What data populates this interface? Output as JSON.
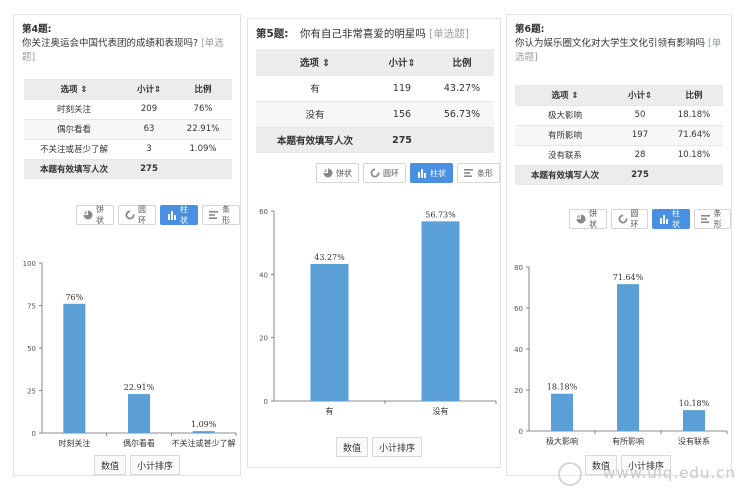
{
  "colors": {
    "bar": "#5a9fd6",
    "active_btn": "#4a90e2",
    "header_bg": "#ececec"
  },
  "table_headers": {
    "option": "选项 ⇕",
    "count": "小计⇕",
    "ratio": "比例"
  },
  "total_label": "本题有效填写人次",
  "chart_buttons": [
    {
      "icon": "pie-icon",
      "label": "饼状"
    },
    {
      "icon": "donut-icon",
      "label": "圆环"
    },
    {
      "icon": "bar-chart-icon",
      "label": "柱状"
    },
    {
      "icon": "bar-horizontal-icon",
      "label": "条形"
    }
  ],
  "bottom_buttons": {
    "values": "数值",
    "sort": "小计排序"
  },
  "watermark": "www.ulq.edu.cn",
  "questions": [
    {
      "num": "第4题:",
      "text": "你关注奥运会中国代表团的成绩和表现吗?",
      "tag": "[单选题]",
      "rows": [
        {
          "option": "时刻关注",
          "count": "209",
          "ratio": "76%"
        },
        {
          "option": "偶尔看看",
          "count": "63",
          "ratio": "22.91%"
        },
        {
          "option": "不关注或甚少了解",
          "count": "3",
          "ratio": "1.09%"
        }
      ],
      "total": "275"
    },
    {
      "num": "第5题:",
      "text": "你有自己非常喜爱的明星吗",
      "tag": "[单选题]",
      "rows": [
        {
          "option": "有",
          "count": "119",
          "ratio": "43.27%"
        },
        {
          "option": "没有",
          "count": "156",
          "ratio": "56.73%"
        }
      ],
      "total": "275"
    },
    {
      "num": "第6题:",
      "text": "你认为娱乐圈文化对大学生文化引领有影响吗",
      "tag": "[单选题]",
      "rows": [
        {
          "option": "极大影响",
          "count": "50",
          "ratio": "18.18%"
        },
        {
          "option": "有所影响",
          "count": "197",
          "ratio": "71.64%"
        },
        {
          "option": "没有联系",
          "count": "28",
          "ratio": "10.18%"
        }
      ],
      "total": "275"
    }
  ],
  "chart_data": [
    {
      "type": "bar",
      "categories": [
        "时刻关注",
        "偶尔看看",
        "不关注或甚少了解"
      ],
      "values": [
        76,
        22.91,
        1.09
      ],
      "labels": [
        "76%",
        "22.91%",
        "1.09%"
      ],
      "ylim": [
        0,
        100
      ],
      "yticks": [
        "0",
        "25",
        "50",
        "75",
        "100"
      ],
      "yticks_values": [
        0,
        25,
        50,
        75,
        100
      ],
      "grid": false
    },
    {
      "type": "bar",
      "categories": [
        "有",
        "没有"
      ],
      "values": [
        43.27,
        56.73
      ],
      "labels": [
        "43.27%",
        "56.73%"
      ],
      "ylim": [
        0,
        60
      ],
      "yticks": [
        "0",
        "20",
        "40",
        "60"
      ],
      "yticks_values": [
        0,
        20,
        40,
        60
      ],
      "grid": false
    },
    {
      "type": "bar",
      "categories": [
        "极大影响",
        "有所影响",
        "没有联系"
      ],
      "values": [
        18.18,
        71.64,
        10.18
      ],
      "labels": [
        "18.18%",
        "71.64%",
        "10.18%"
      ],
      "ylim": [
        0,
        80
      ],
      "yticks": [
        "0",
        "20",
        "40",
        "60",
        "80"
      ],
      "yticks_values": [
        0,
        20,
        40,
        60,
        80
      ],
      "grid": false
    }
  ]
}
